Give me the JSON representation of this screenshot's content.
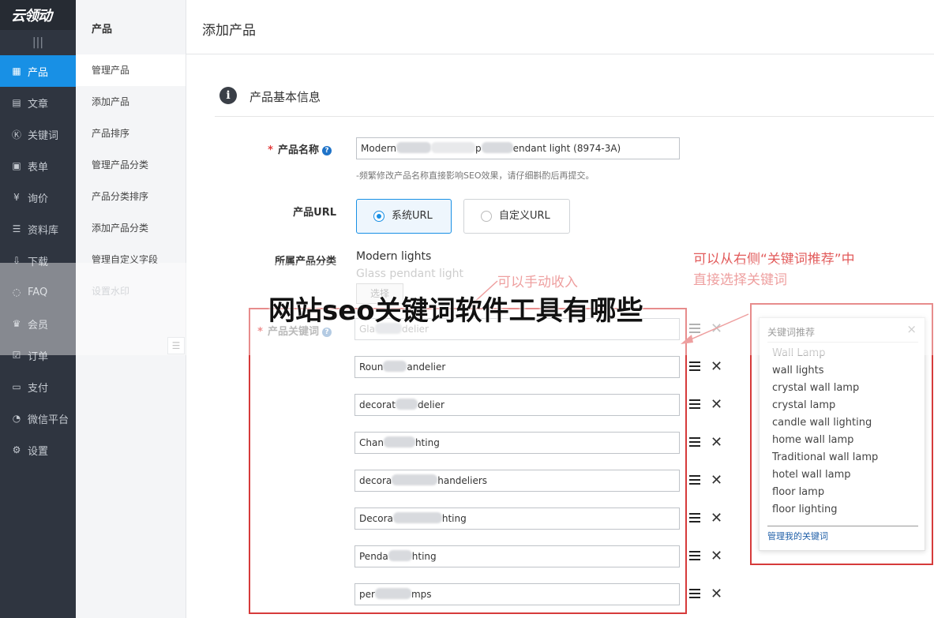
{
  "app": {
    "logo": "云领动"
  },
  "nav": {
    "collapse_icon": "|||",
    "items": [
      {
        "label": "产品",
        "icon": "grid-icon"
      },
      {
        "label": "文章",
        "icon": "article-icon"
      },
      {
        "label": "关键词",
        "icon": "keyword-icon"
      },
      {
        "label": "表单",
        "icon": "form-icon"
      },
      {
        "label": "询价",
        "icon": "inquiry-icon"
      },
      {
        "label": "资料库",
        "icon": "library-icon"
      },
      {
        "label": "下载",
        "icon": "download-icon"
      },
      {
        "label": "FAQ",
        "icon": "faq-icon"
      },
      {
        "label": "会员",
        "icon": "crown-icon"
      },
      {
        "label": "订单",
        "icon": "order-icon"
      },
      {
        "label": "支付",
        "icon": "pay-icon"
      },
      {
        "label": "微信平台",
        "icon": "wechat-icon"
      },
      {
        "label": "设置",
        "icon": "gear-icon"
      }
    ]
  },
  "subnav": {
    "title": "产品",
    "items": [
      "管理产品",
      "添加产品",
      "产品排序",
      "管理产品分类",
      "产品分类排序",
      "添加产品分类",
      "管理自定义字段",
      "设置水印"
    ]
  },
  "page": {
    "title": "添加产品"
  },
  "section": {
    "title": "产品基本信息"
  },
  "form": {
    "name_label": "产品名称",
    "name_value_start": "Modern",
    "name_value_mid": "p",
    "name_value_end": "endant light (8974-3A)",
    "name_hint": "-频繁修改产品名称直接影响SEO效果，请仔细斟酌后再提交。",
    "url_label": "产品URL",
    "url_option_system": "系统URL",
    "url_option_custom": "自定义URL",
    "category_label": "所属产品分类",
    "category_primary": "Modern lights",
    "category_secondary": "Glass pendant light",
    "choose_button": "选择",
    "keywords_label": "产品关键词",
    "keywords": [
      {
        "start": "Gla",
        "end": "delier"
      },
      {
        "start": "Roun",
        "end": "andelier"
      },
      {
        "start": "decorat",
        "end": "delier"
      },
      {
        "start": "Chan",
        "end": "hting"
      },
      {
        "start": "decora",
        "end": "handeliers"
      },
      {
        "start": "Decora",
        "end": "hting"
      },
      {
        "start": "Penda",
        "end": "hting"
      },
      {
        "start": "per",
        "end": "mps"
      }
    ]
  },
  "keyword_panel": {
    "title": "关键词推荐",
    "close": "×",
    "items": [
      "Wall Lamp",
      "wall lights",
      "crystal wall lamp",
      "crystal lamp",
      "candle wall lighting",
      "home wall lamp",
      "Traditional wall lamp",
      "hotel wall lamp",
      "floor lamp",
      "floor lighting"
    ],
    "manage_link": "管理我的关键词"
  },
  "annotations": {
    "manual_note": "可以手动收入",
    "panel_note_line1": "可以从右侧“关键词推荐”中",
    "panel_note_line2": "直接选择关键词"
  },
  "overlay": {
    "headline": "网站seo关键词软件工具有哪些"
  },
  "colors": {
    "accent": "#1890e5",
    "nav_bg": "#2f3540",
    "annotation": "#d63a3a"
  }
}
